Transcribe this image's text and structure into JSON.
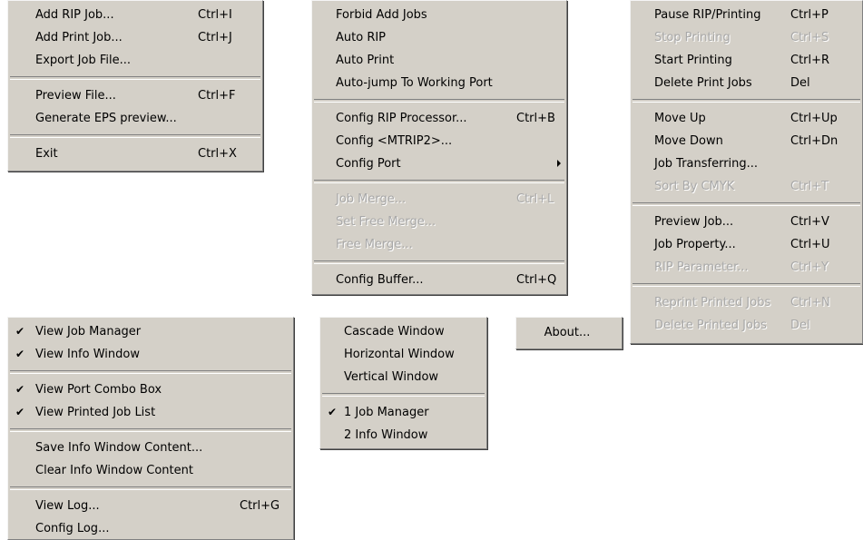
{
  "menus": {
    "file": {
      "items": [
        {
          "label": "Add RIP Job...",
          "shortcut": "Ctrl+I"
        },
        {
          "label": "Add Print Job...",
          "shortcut": "Ctrl+J"
        },
        {
          "label": "Export Job File...",
          "shortcut": ""
        },
        {
          "label": "Preview File...",
          "shortcut": "Ctrl+F"
        },
        {
          "label": "Generate EPS preview...",
          "shortcut": ""
        },
        {
          "label": "Exit",
          "shortcut": "Ctrl+X"
        }
      ]
    },
    "rip": {
      "items": [
        {
          "label": "Forbid Add Jobs",
          "shortcut": ""
        },
        {
          "label": "Auto RIP",
          "shortcut": ""
        },
        {
          "label": "Auto Print",
          "shortcut": ""
        },
        {
          "label": "Auto-jump To Working Port",
          "shortcut": ""
        },
        {
          "label": "Config RIP Processor...",
          "shortcut": "Ctrl+B"
        },
        {
          "label": "Config <MTRIP2>...",
          "shortcut": ""
        },
        {
          "label": "Config Port",
          "shortcut": "",
          "submenu_icon": "chevron-right-icon"
        },
        {
          "label": "Job Merge...",
          "shortcut": "Ctrl+L",
          "disabled": true
        },
        {
          "label": "Set Free Merge...",
          "shortcut": "",
          "disabled": true
        },
        {
          "label": "Free Merge...",
          "shortcut": "",
          "disabled": true
        },
        {
          "label": "Config Buffer...",
          "shortcut": "Ctrl+Q"
        }
      ]
    },
    "job": {
      "items": [
        {
          "label": "Pause RIP/Printing",
          "shortcut": "Ctrl+P"
        },
        {
          "label": "Stop Printing",
          "shortcut": "Ctrl+S",
          "disabled": true
        },
        {
          "label": "Start Printing",
          "shortcut": "Ctrl+R"
        },
        {
          "label": "Delete Print Jobs",
          "shortcut": "Del"
        },
        {
          "label": "Move Up",
          "shortcut": "Ctrl+Up"
        },
        {
          "label": "Move Down",
          "shortcut": "Ctrl+Dn"
        },
        {
          "label": "Job Transferring...",
          "shortcut": ""
        },
        {
          "label": "Sort By CMYK",
          "shortcut": "Ctrl+T",
          "disabled": true
        },
        {
          "label": "Preview Job...",
          "shortcut": "Ctrl+V"
        },
        {
          "label": "Job Property...",
          "shortcut": "Ctrl+U"
        },
        {
          "label": "RIP Parameter...",
          "shortcut": "Ctrl+Y",
          "disabled": true
        },
        {
          "label": "Reprint Printed Jobs",
          "shortcut": "Ctrl+N",
          "disabled": true
        },
        {
          "label": "Delete Printed Jobs",
          "shortcut": "Del",
          "disabled": true
        }
      ]
    },
    "view": {
      "items": [
        {
          "label": "View Job Manager",
          "shortcut": "",
          "checked": true
        },
        {
          "label": "View Info Window",
          "shortcut": "",
          "checked": true
        },
        {
          "label": "View Port Combo Box",
          "shortcut": "",
          "checked": true
        },
        {
          "label": "View Printed Job List",
          "shortcut": "",
          "checked": true
        },
        {
          "label": "Save Info Window Content...",
          "shortcut": ""
        },
        {
          "label": "Clear Info Window Content",
          "shortcut": ""
        },
        {
          "label": "View Log...",
          "shortcut": "Ctrl+G"
        },
        {
          "label": "Config Log...",
          "shortcut": ""
        }
      ]
    },
    "window": {
      "items": [
        {
          "label": "Cascade Window"
        },
        {
          "label": "Horizontal Window"
        },
        {
          "label": "Vertical Window"
        },
        {
          "label": "1 Job Manager",
          "checked": true
        },
        {
          "label": "2 Info Window"
        }
      ]
    },
    "help": {
      "items": [
        {
          "label": "About..."
        }
      ]
    }
  },
  "icons": {
    "check": "✔"
  },
  "colors": {
    "menu_background": "#d4d0c8",
    "disabled_text": "#a8a8a8",
    "text": "#000000"
  }
}
